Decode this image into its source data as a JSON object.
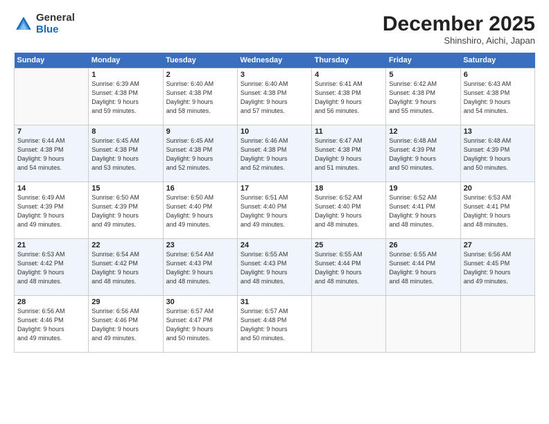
{
  "logo": {
    "general": "General",
    "blue": "Blue"
  },
  "title": "December 2025",
  "location": "Shinshiro, Aichi, Japan",
  "days_of_week": [
    "Sunday",
    "Monday",
    "Tuesday",
    "Wednesday",
    "Thursday",
    "Friday",
    "Saturday"
  ],
  "weeks": [
    [
      {
        "num": "",
        "info": ""
      },
      {
        "num": "1",
        "info": "Sunrise: 6:39 AM\nSunset: 4:38 PM\nDaylight: 9 hours\nand 59 minutes."
      },
      {
        "num": "2",
        "info": "Sunrise: 6:40 AM\nSunset: 4:38 PM\nDaylight: 9 hours\nand 58 minutes."
      },
      {
        "num": "3",
        "info": "Sunrise: 6:40 AM\nSunset: 4:38 PM\nDaylight: 9 hours\nand 57 minutes."
      },
      {
        "num": "4",
        "info": "Sunrise: 6:41 AM\nSunset: 4:38 PM\nDaylight: 9 hours\nand 56 minutes."
      },
      {
        "num": "5",
        "info": "Sunrise: 6:42 AM\nSunset: 4:38 PM\nDaylight: 9 hours\nand 55 minutes."
      },
      {
        "num": "6",
        "info": "Sunrise: 6:43 AM\nSunset: 4:38 PM\nDaylight: 9 hours\nand 54 minutes."
      }
    ],
    [
      {
        "num": "7",
        "info": "Sunrise: 6:44 AM\nSunset: 4:38 PM\nDaylight: 9 hours\nand 54 minutes."
      },
      {
        "num": "8",
        "info": "Sunrise: 6:45 AM\nSunset: 4:38 PM\nDaylight: 9 hours\nand 53 minutes."
      },
      {
        "num": "9",
        "info": "Sunrise: 6:45 AM\nSunset: 4:38 PM\nDaylight: 9 hours\nand 52 minutes."
      },
      {
        "num": "10",
        "info": "Sunrise: 6:46 AM\nSunset: 4:38 PM\nDaylight: 9 hours\nand 52 minutes."
      },
      {
        "num": "11",
        "info": "Sunrise: 6:47 AM\nSunset: 4:38 PM\nDaylight: 9 hours\nand 51 minutes."
      },
      {
        "num": "12",
        "info": "Sunrise: 6:48 AM\nSunset: 4:39 PM\nDaylight: 9 hours\nand 50 minutes."
      },
      {
        "num": "13",
        "info": "Sunrise: 6:48 AM\nSunset: 4:39 PM\nDaylight: 9 hours\nand 50 minutes."
      }
    ],
    [
      {
        "num": "14",
        "info": "Sunrise: 6:49 AM\nSunset: 4:39 PM\nDaylight: 9 hours\nand 49 minutes."
      },
      {
        "num": "15",
        "info": "Sunrise: 6:50 AM\nSunset: 4:39 PM\nDaylight: 9 hours\nand 49 minutes."
      },
      {
        "num": "16",
        "info": "Sunrise: 6:50 AM\nSunset: 4:40 PM\nDaylight: 9 hours\nand 49 minutes."
      },
      {
        "num": "17",
        "info": "Sunrise: 6:51 AM\nSunset: 4:40 PM\nDaylight: 9 hours\nand 49 minutes."
      },
      {
        "num": "18",
        "info": "Sunrise: 6:52 AM\nSunset: 4:40 PM\nDaylight: 9 hours\nand 48 minutes."
      },
      {
        "num": "19",
        "info": "Sunrise: 6:52 AM\nSunset: 4:41 PM\nDaylight: 9 hours\nand 48 minutes."
      },
      {
        "num": "20",
        "info": "Sunrise: 6:53 AM\nSunset: 4:41 PM\nDaylight: 9 hours\nand 48 minutes."
      }
    ],
    [
      {
        "num": "21",
        "info": "Sunrise: 6:53 AM\nSunset: 4:42 PM\nDaylight: 9 hours\nand 48 minutes."
      },
      {
        "num": "22",
        "info": "Sunrise: 6:54 AM\nSunset: 4:42 PM\nDaylight: 9 hours\nand 48 minutes."
      },
      {
        "num": "23",
        "info": "Sunrise: 6:54 AM\nSunset: 4:43 PM\nDaylight: 9 hours\nand 48 minutes."
      },
      {
        "num": "24",
        "info": "Sunrise: 6:55 AM\nSunset: 4:43 PM\nDaylight: 9 hours\nand 48 minutes."
      },
      {
        "num": "25",
        "info": "Sunrise: 6:55 AM\nSunset: 4:44 PM\nDaylight: 9 hours\nand 48 minutes."
      },
      {
        "num": "26",
        "info": "Sunrise: 6:55 AM\nSunset: 4:44 PM\nDaylight: 9 hours\nand 48 minutes."
      },
      {
        "num": "27",
        "info": "Sunrise: 6:56 AM\nSunset: 4:45 PM\nDaylight: 9 hours\nand 49 minutes."
      }
    ],
    [
      {
        "num": "28",
        "info": "Sunrise: 6:56 AM\nSunset: 4:46 PM\nDaylight: 9 hours\nand 49 minutes."
      },
      {
        "num": "29",
        "info": "Sunrise: 6:56 AM\nSunset: 4:46 PM\nDaylight: 9 hours\nand 49 minutes."
      },
      {
        "num": "30",
        "info": "Sunrise: 6:57 AM\nSunset: 4:47 PM\nDaylight: 9 hours\nand 50 minutes."
      },
      {
        "num": "31",
        "info": "Sunrise: 6:57 AM\nSunset: 4:48 PM\nDaylight: 9 hours\nand 50 minutes."
      },
      {
        "num": "",
        "info": ""
      },
      {
        "num": "",
        "info": ""
      },
      {
        "num": "",
        "info": ""
      }
    ]
  ]
}
